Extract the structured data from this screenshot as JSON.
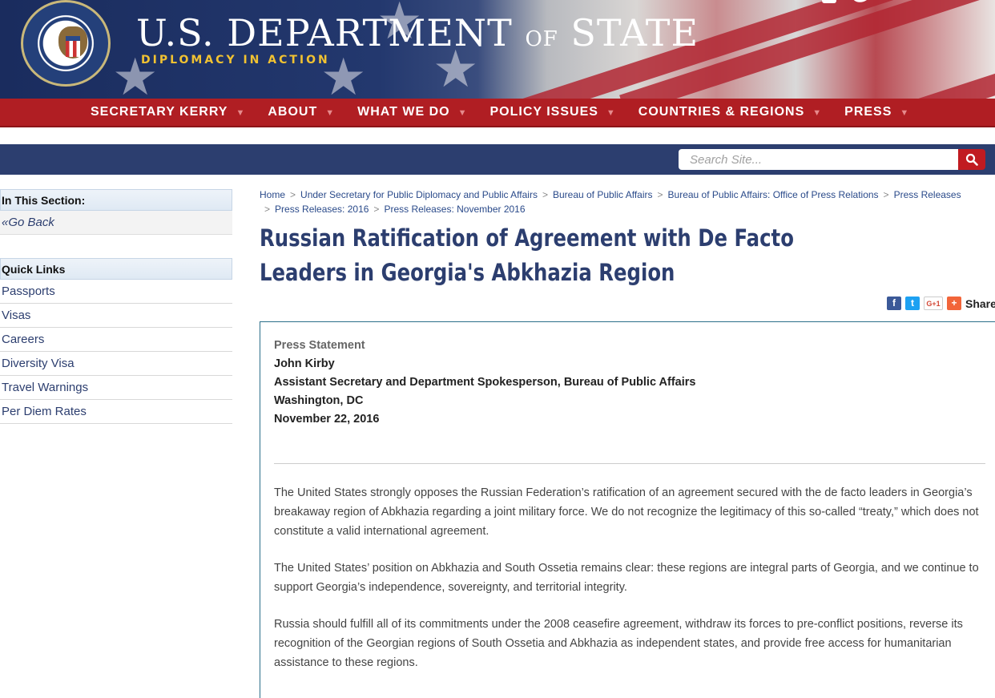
{
  "header": {
    "site_title_main": "U.S. DEPARTMENT ",
    "site_title_of": "OF",
    "site_title_end": " STATE",
    "tagline": "DIPLOMACY IN ACTION"
  },
  "nav": {
    "items": [
      {
        "label": "SECRETARY KERRY"
      },
      {
        "label": "ABOUT"
      },
      {
        "label": "WHAT WE DO"
      },
      {
        "label": "POLICY ISSUES"
      },
      {
        "label": "COUNTRIES & REGIONS"
      },
      {
        "label": "PRESS"
      }
    ]
  },
  "search": {
    "placeholder": "Search Site..."
  },
  "sidebar": {
    "section_heading": "In This Section:",
    "go_back": "Go Back",
    "quick_links_heading": "Quick Links",
    "quick_links": [
      "Passports",
      "Visas",
      "Careers",
      "Diversity Visa",
      "Travel Warnings",
      "Per Diem Rates"
    ]
  },
  "breadcrumb": [
    "Home",
    "Under Secretary for Public Diplomacy and Public Affairs",
    "Bureau of Public Affairs",
    "Bureau of Public Affairs: Office of Press Relations",
    "Press Releases",
    "Press Releases: 2016",
    "Press Releases: November 2016"
  ],
  "article": {
    "title": "Russian Ratification of Agreement with De Facto Leaders in Georgia's Abkhazia Region",
    "share_label": "Share",
    "type": "Press Statement",
    "author": "John Kirby",
    "author_title": "Assistant Secretary and Department Spokesperson, Bureau of Public Affairs",
    "location": "Washington, DC",
    "date": "November 22, 2016",
    "paragraphs": [
      "The United States strongly opposes the Russian Federation’s ratification of an agreement secured with the de facto leaders in Georgia’s breakaway region of Abkhazia regarding a joint military force. We do not recognize the legitimacy of this so-called “treaty,” which does not constitute a valid international agreement.",
      "The United States’ position on Abkhazia and South Ossetia remains clear: these regions are integral parts of Georgia, and we continue to support Georgia’s independence, sovereignty, and territorial integrity.",
      "Russia should fulfill all of its commitments under the 2008 ceasefire agreement, withdraw its forces to pre-conflict positions, reverse its recognition of the Georgian regions of South Ossetia and Abkhazia as independent states, and provide free access for humanitarian assistance to these regions."
    ]
  },
  "icons": {
    "brand_blue": "#2c3e6f",
    "brand_red": "#b01e23"
  }
}
